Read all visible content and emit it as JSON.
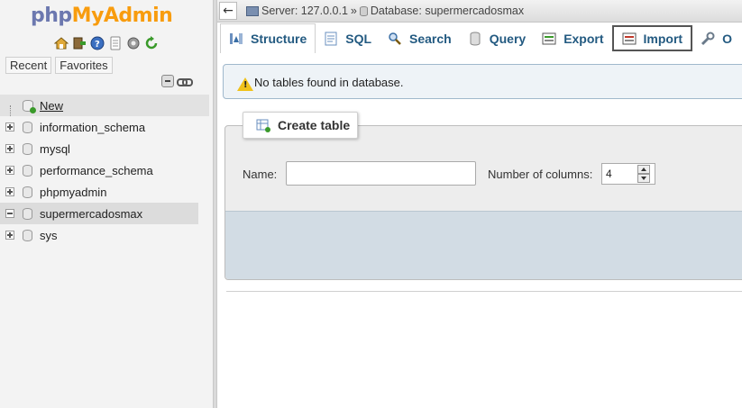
{
  "logo": {
    "php": "php",
    "myadmin": "MyAdmin"
  },
  "nav_icons": [
    "home-icon",
    "logout-icon",
    "help-icon",
    "docs-icon",
    "settings-icon",
    "reload-icon"
  ],
  "recent_tabs": {
    "recent": "Recent",
    "favorites": "Favorites"
  },
  "tree": {
    "new": "New",
    "databases": [
      {
        "name": "information_schema",
        "selected": false
      },
      {
        "name": "mysql",
        "selected": false
      },
      {
        "name": "performance_schema",
        "selected": false
      },
      {
        "name": "phpmyadmin",
        "selected": false
      },
      {
        "name": "supermercadosmax",
        "selected": true
      },
      {
        "name": "sys",
        "selected": false
      }
    ]
  },
  "top_bar": {
    "collapse_arrow": "←",
    "server": "Server: 127.0.0.1",
    "separator": "»",
    "database": "Database: supermercadosmax"
  },
  "tabs": [
    {
      "label": "Structure",
      "icon": "structure-icon",
      "active": true
    },
    {
      "label": "SQL",
      "icon": "sql-icon",
      "active": false
    },
    {
      "label": "Search",
      "icon": "search-icon",
      "active": false
    },
    {
      "label": "Query",
      "icon": "query-icon",
      "active": false
    },
    {
      "label": "Export",
      "icon": "export-icon",
      "active": false
    },
    {
      "label": "Import",
      "icon": "import-icon",
      "active": false
    },
    {
      "label": "O",
      "icon": "wrench-icon",
      "active": false
    }
  ],
  "notice": {
    "text": "No tables found in database."
  },
  "create_table": {
    "legend": "Create table",
    "name_label": "Name:",
    "name_value": "",
    "columns_label": "Number of columns:",
    "columns_value": "4"
  },
  "colors": {
    "tab_text": "#235a81",
    "logo_php": "#6c78af",
    "logo_myadmin": "#f89c0e",
    "notice_bg": "#eef3f7",
    "footer_bg": "#d2dce4"
  }
}
